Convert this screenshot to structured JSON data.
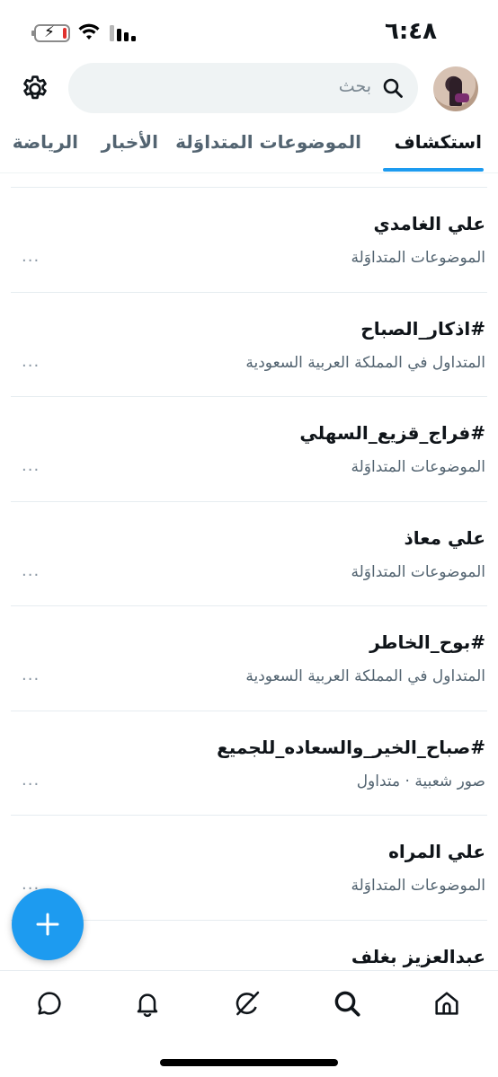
{
  "status_bar": {
    "time": "٦:٤٨"
  },
  "header": {
    "search_placeholder": "بحث"
  },
  "tabs": [
    {
      "label": "استكشاف",
      "active": true
    },
    {
      "label": "الموضوعات المتداوَلة",
      "active": false
    },
    {
      "label": "الأخبار",
      "active": false
    },
    {
      "label": "الرياضة",
      "active": false
    }
  ],
  "trends": [
    {
      "title": "علي الغامدي",
      "subtitle": "الموضوعات المتداوَلة",
      "more": "..."
    },
    {
      "title": "#اذكار_الصباح",
      "subtitle": "المتداول في المملكة العربية السعودية",
      "more": "..."
    },
    {
      "title": "#فراج_قزيع_السهلي",
      "subtitle": "الموضوعات المتداوَلة",
      "more": "..."
    },
    {
      "title": "علي معاذ",
      "subtitle": "الموضوعات المتداوَلة",
      "more": "..."
    },
    {
      "title": "#بوح_الخاطر",
      "subtitle": "المتداول في المملكة العربية السعودية",
      "more": "..."
    },
    {
      "title": "#صباح_الخير_والسعاده_للجميع",
      "subtitle": "صور شعبية · متداول",
      "more": "..."
    },
    {
      "title": "علي المراه",
      "subtitle": "الموضوعات المتداوَلة",
      "more": "..."
    },
    {
      "title": "عبدالعزيز بغلف",
      "subtitle": "",
      "more": ""
    }
  ],
  "colors": {
    "accent": "#1d9bf0",
    "text_primary": "#0f1419",
    "text_secondary": "#536471"
  },
  "icons": {
    "settings": "gear-icon",
    "search": "search-icon",
    "compose": "plus-icon",
    "nav": [
      "home-icon",
      "search-icon",
      "grok-icon",
      "bell-icon",
      "messages-icon"
    ]
  }
}
